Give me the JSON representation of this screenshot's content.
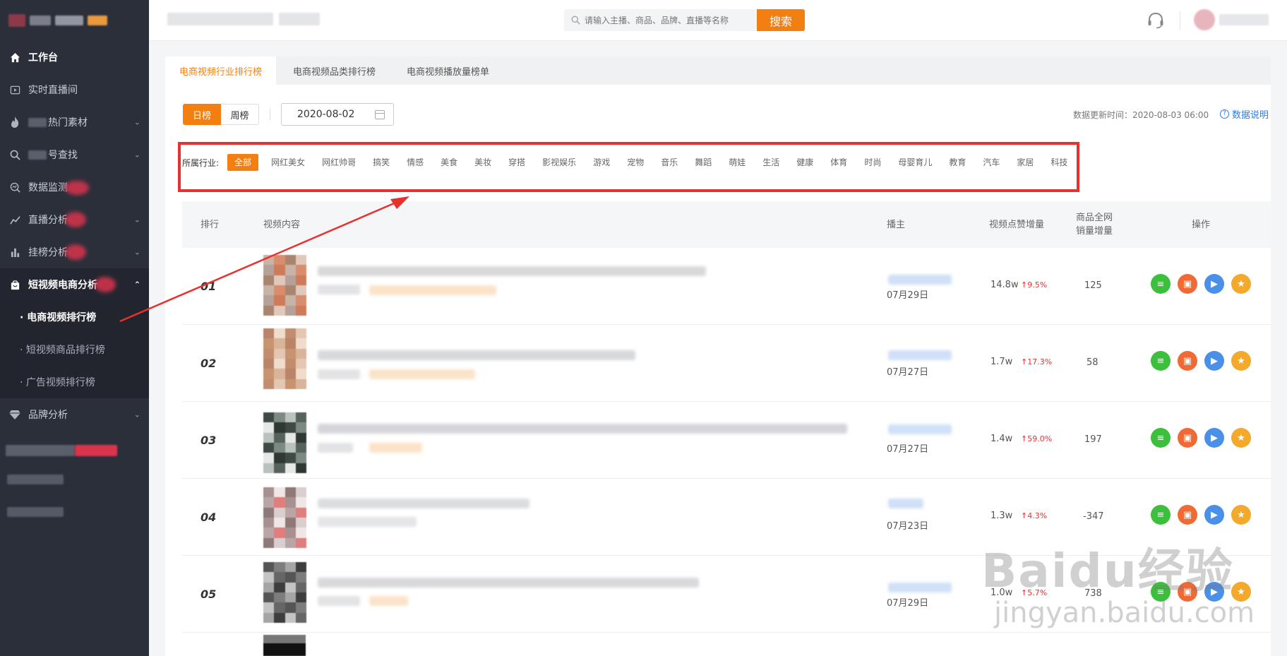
{
  "sidebar": {
    "items": [
      {
        "label": "工作台"
      },
      {
        "label": "实时直播间"
      },
      {
        "label": "热门素材"
      },
      {
        "label": "号查找"
      },
      {
        "label": "数据监测"
      },
      {
        "label": "直播分析"
      },
      {
        "label": "挂榜分析"
      },
      {
        "label": "短视频电商分析"
      },
      {
        "label": "品牌分析"
      }
    ],
    "sub_items": [
      {
        "label": "· 电商视频排行榜"
      },
      {
        "label": "· 短视频商品排行榜"
      },
      {
        "label": "· 广告视频排行榜"
      }
    ]
  },
  "topbar": {
    "search_placeholder": "请输入主播、商品、品牌、直播等名称",
    "search_button": "搜索"
  },
  "tabs": [
    "电商视频行业排行榜",
    "电商视频品类排行榜",
    "电商视频播放量榜单"
  ],
  "filters": {
    "day_label": "日榜",
    "week_label": "周榜",
    "date": "2020-08-02",
    "updated_text": "数据更新时间：2020-08-03 06:00",
    "help_label": "数据说明"
  },
  "industry": {
    "label": "所属行业:",
    "options": [
      "全部",
      "网红美女",
      "网红帅哥",
      "搞笑",
      "情感",
      "美食",
      "美妆",
      "穿搭",
      "影视娱乐",
      "游戏",
      "宠物",
      "音乐",
      "舞蹈",
      "萌娃",
      "生活",
      "健康",
      "体育",
      "时尚",
      "母婴育儿",
      "教育",
      "汽车",
      "家居",
      "科技"
    ]
  },
  "table": {
    "headers": {
      "rank": "排行",
      "content": "视频内容",
      "anchor": "播主",
      "likes": "视频点赞增量",
      "sales_line1": "商品全网",
      "sales_line2": "销量增量",
      "ops": "操作"
    },
    "rows": [
      {
        "rank": "01",
        "date": "07月29日",
        "likes": "14.8w",
        "pct": "↑9.5%",
        "sales": "125"
      },
      {
        "rank": "02",
        "date": "07月27日",
        "likes": "1.7w",
        "pct": "↑17.3%",
        "sales": "58"
      },
      {
        "rank": "03",
        "date": "07月27日",
        "likes": "1.4w",
        "pct": "↑59.0%",
        "sales": "197"
      },
      {
        "rank": "04",
        "date": "07月23日",
        "likes": "1.3w",
        "pct": "↑4.3%",
        "sales": "-347"
      },
      {
        "rank": "05",
        "date": "07月29日",
        "likes": "1.0w",
        "pct": "↑5.7%",
        "sales": "738"
      }
    ]
  },
  "icons": {
    "home": "home-icon",
    "live": "play-square-icon",
    "hot": "flame-icon",
    "search": "search-icon",
    "monitor": "magnify-chart-icon",
    "live_analysis": "line-chart-icon",
    "bar": "bar-chart-icon",
    "bag": "shopping-bag-icon",
    "diamond": "diamond-icon",
    "headset": "headset-icon",
    "calendar": "calendar-icon"
  },
  "watermark": {
    "main": "Baidu经验",
    "sub": "jingyan.baidu.com"
  },
  "colors": {
    "accent": "#f27f10",
    "annotation": "#e8312f",
    "sidebar_bg": "#2b2f3a",
    "link": "#2d7be5"
  }
}
